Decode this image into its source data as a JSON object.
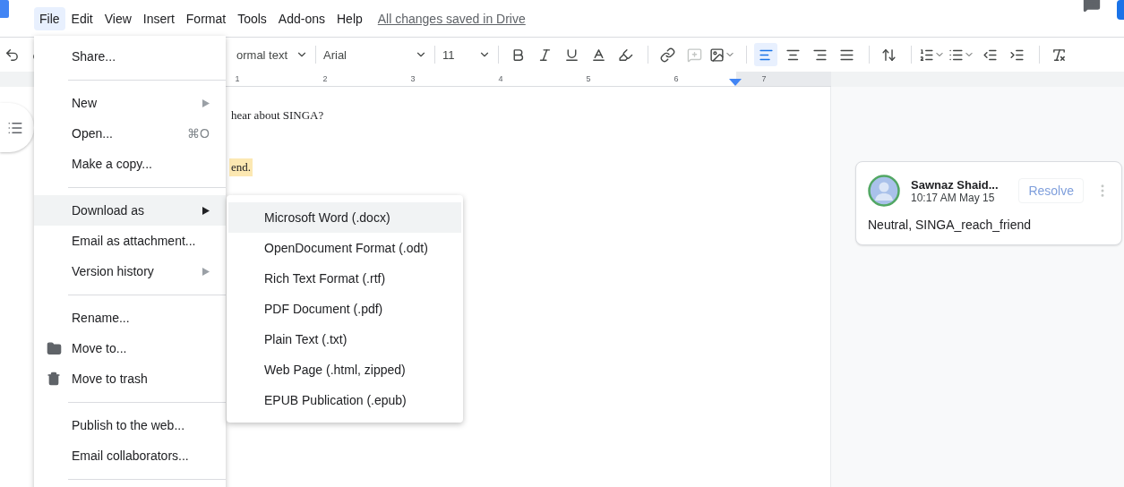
{
  "menu_bar": {
    "items": [
      {
        "label": "File",
        "selected": true
      },
      {
        "label": "Edit",
        "selected": false
      },
      {
        "label": "View",
        "selected": false
      },
      {
        "label": "Insert",
        "selected": false
      },
      {
        "label": "Format",
        "selected": false
      },
      {
        "label": "Tools",
        "selected": false
      },
      {
        "label": "Add-ons",
        "selected": false
      },
      {
        "label": "Help",
        "selected": false
      }
    ],
    "save_status": "All changes saved in Drive"
  },
  "toolbar": {
    "style": "ormal text",
    "font": "Arial",
    "size": "11",
    "comment_button": {
      "disabled": true
    },
    "alignments": [
      {
        "selected": true
      },
      {
        "selected": false
      },
      {
        "selected": false
      },
      {
        "selected": false
      }
    ]
  },
  "ruler": {
    "marks": [
      "1",
      "2",
      "3",
      "4",
      "5",
      "6",
      "7"
    ]
  },
  "document": {
    "lines": [
      {
        "text": "hear about SINGA?",
        "highlighted": false
      },
      {
        "text": "end.",
        "highlighted": true
      }
    ]
  },
  "file_menu": {
    "items": [
      {
        "kind": "item",
        "label": "Share...",
        "selected": false
      },
      {
        "kind": "divider"
      },
      {
        "kind": "item",
        "label": "New",
        "submenu": true,
        "selected": false
      },
      {
        "kind": "item",
        "label": "Open...",
        "shortcut": "⌘O",
        "selected": false
      },
      {
        "kind": "item",
        "label": "Make a copy...",
        "selected": false
      },
      {
        "kind": "divider"
      },
      {
        "kind": "item",
        "label": "Download as",
        "submenu": true,
        "selected": true
      },
      {
        "kind": "item",
        "label": "Email as attachment...",
        "selected": false
      },
      {
        "kind": "item",
        "label": "Version history",
        "submenu": true,
        "selected": false
      },
      {
        "kind": "divider"
      },
      {
        "kind": "item",
        "label": "Rename...",
        "selected": false
      },
      {
        "kind": "folder",
        "label": "Move to...",
        "selected": false
      },
      {
        "kind": "trash",
        "label": "Move to trash",
        "selected": false
      },
      {
        "kind": "divider"
      },
      {
        "kind": "item",
        "label": "Publish to the web...",
        "selected": false
      },
      {
        "kind": "item",
        "label": "Email collaborators...",
        "selected": false
      },
      {
        "kind": "divider"
      }
    ]
  },
  "download_menu": {
    "items": [
      {
        "label": "Microsoft Word (.docx)",
        "selected": true
      },
      {
        "label": "OpenDocument Format (.odt)",
        "selected": false
      },
      {
        "label": "Rich Text Format (.rtf)",
        "selected": false
      },
      {
        "label": "PDF Document (.pdf)",
        "selected": false
      },
      {
        "label": "Plain Text (.txt)",
        "selected": false
      },
      {
        "label": "Web Page (.html, zipped)",
        "selected": false
      },
      {
        "label": "EPUB Publication (.epub)",
        "selected": false
      }
    ]
  },
  "comment": {
    "author": "Sawnaz Shaid...",
    "time": "10:17 AM May 15",
    "resolve": "Resolve",
    "text": "Neutral, SINGA_reach_friend"
  }
}
